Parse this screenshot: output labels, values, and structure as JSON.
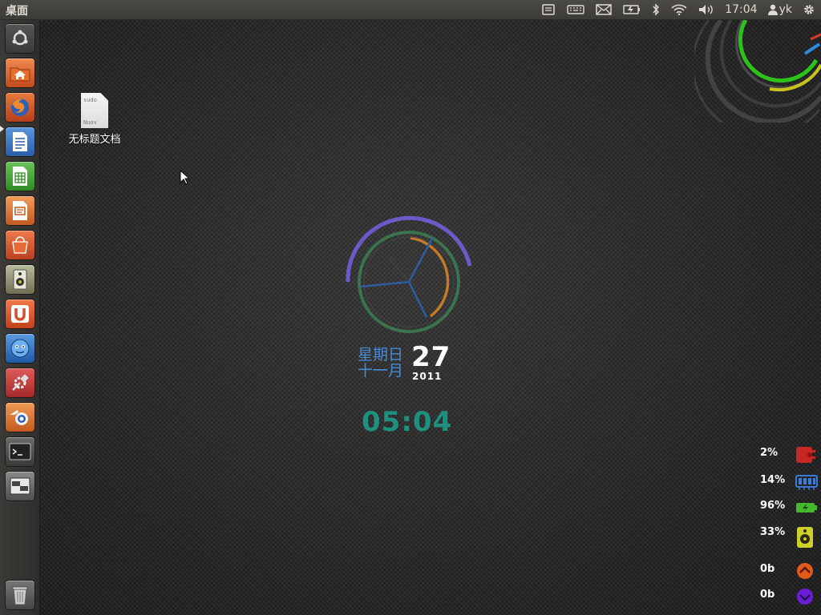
{
  "top_panel": {
    "title": "桌面",
    "time": "17:04",
    "user": "yk"
  },
  "launcher": {
    "items": [
      {
        "name": "dash-home",
        "icon": "ubuntu-logo-icon",
        "color": "#4a4a4a"
      },
      {
        "name": "home-folder",
        "icon": "folder-home-icon",
        "color": "#d95e2b"
      },
      {
        "name": "firefox",
        "icon": "firefox-icon",
        "color": "#c24a1e",
        "running": true
      },
      {
        "name": "libreoffice-writer",
        "icon": "writer-icon",
        "color": "#3b78c2"
      },
      {
        "name": "libreoffice-calc",
        "icon": "calc-icon",
        "color": "#4a9e3b"
      },
      {
        "name": "libreoffice-impress",
        "icon": "impress-icon",
        "color": "#d26a2e"
      },
      {
        "name": "ubuntu-software-center",
        "icon": "software-center-icon",
        "color": "#d2522e"
      },
      {
        "name": "banshee-music",
        "icon": "speaker-icon",
        "color": "#8a8a60"
      },
      {
        "name": "ubuntu-one",
        "icon": "ubuntu-one-icon",
        "color": "#d2522e"
      },
      {
        "name": "empathy",
        "icon": "chat-face-icon",
        "color": "#2c6db5"
      },
      {
        "name": "system-settings",
        "icon": "settings-tools-icon",
        "color": "#c23a3a"
      },
      {
        "name": "blender",
        "icon": "blender-icon",
        "color": "#d2622e"
      },
      {
        "name": "terminal",
        "icon": "terminal-icon",
        "color": "#4a4a4a"
      },
      {
        "name": "workspace-switcher",
        "icon": "workspace-icon",
        "color": "#5a5a5a"
      },
      {
        "name": "trash",
        "icon": "trash-icon",
        "color": "#5a5a5a"
      }
    ]
  },
  "desktop": {
    "file_label": "无标题文档",
    "file_preview_line1": "sudo",
    "file_preview_line2": "Nuov"
  },
  "clock": {
    "weekday": "星期日",
    "month": "十一月",
    "day": "27",
    "year": "2011",
    "time": "05:04"
  },
  "stats": [
    {
      "value": "2%",
      "icon": "cpu-icon",
      "color": "#c62828"
    },
    {
      "value": "14%",
      "icon": "memory-icon",
      "color": "#3a7bd5"
    },
    {
      "value": "96%",
      "icon": "battery-icon",
      "color": "#45b82c"
    },
    {
      "value": "33%",
      "icon": "disk-icon",
      "color": "#cfcf2a"
    },
    {
      "value": "0b",
      "icon": "upload-icon",
      "color": "#e05a1c"
    },
    {
      "value": "0b",
      "icon": "download-icon",
      "color": "#6a1fd6"
    }
  ]
}
